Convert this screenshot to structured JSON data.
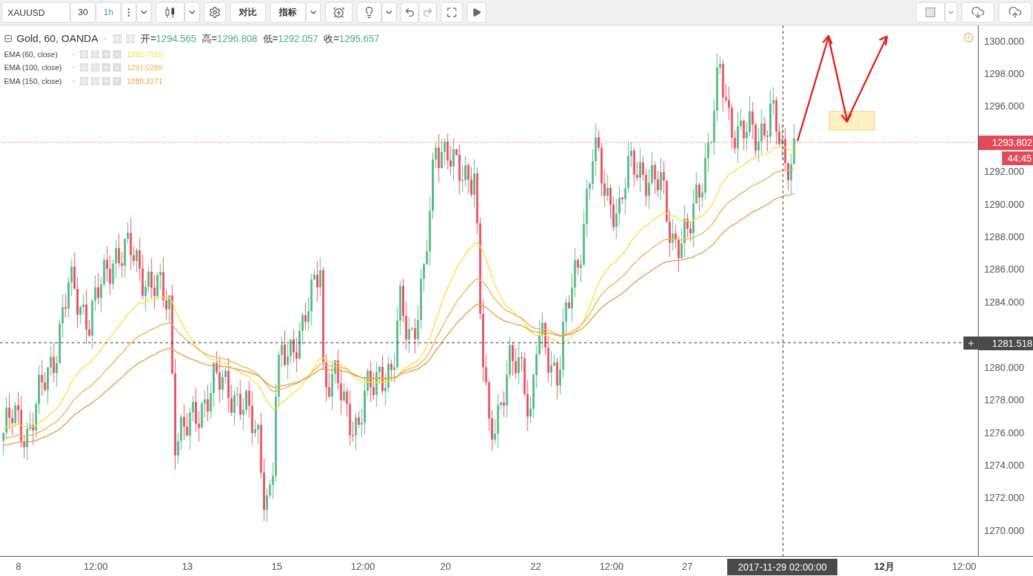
{
  "toolbar": {
    "symbol": "XAUUSD",
    "intervals": [
      {
        "label": "30",
        "selected": false
      },
      {
        "label": "1h",
        "selected": true
      }
    ],
    "buttons": [
      "对比",
      "指标"
    ]
  },
  "legend": {
    "title": "Gold, 60, OANDA",
    "ohlc": [
      {
        "label": "开=",
        "value": "1294.565"
      },
      {
        "label": "高=",
        "value": "1296.808"
      },
      {
        "label": "低=",
        "value": "1292.057"
      },
      {
        "label": "收=",
        "value": "1295.657"
      }
    ],
    "indicators": [
      {
        "name": "EMA (60, close)",
        "value": "1292.7010",
        "color": "#f5e33f"
      },
      {
        "name": "EMA (100, close)",
        "value": "1291.0289",
        "color": "#f0b45a"
      },
      {
        "name": "EMA (150, close)",
        "value": "1289.3171",
        "color": "#e8a04a"
      }
    ]
  },
  "price_axis": {
    "labels": [
      "1300.000",
      "1298.000",
      "1296.000",
      "1292.000",
      "1290.000",
      "1288.000",
      "1286.000",
      "1284.000",
      "1280.000",
      "1278.000",
      "1276.000",
      "1274.000",
      "1272.000",
      "1270.000"
    ],
    "last_price": "1293.802",
    "countdown": "44:45",
    "crosshair_price": "1281.518"
  },
  "time_axis": {
    "labels": [
      {
        "text": "8",
        "bold": false
      },
      {
        "text": "12:00",
        "bold": false
      },
      {
        "text": "13",
        "bold": false
      },
      {
        "text": "15",
        "bold": false
      },
      {
        "text": "12:00",
        "bold": false
      },
      {
        "text": "20",
        "bold": false
      },
      {
        "text": "22",
        "bold": false
      },
      {
        "text": "12:00",
        "bold": false
      },
      {
        "text": "27",
        "bold": false
      },
      {
        "text": "12月",
        "bold": true
      },
      {
        "text": "12:00",
        "bold": false
      }
    ],
    "crosshair_time": "2017-11-29 02:00:00"
  }
}
